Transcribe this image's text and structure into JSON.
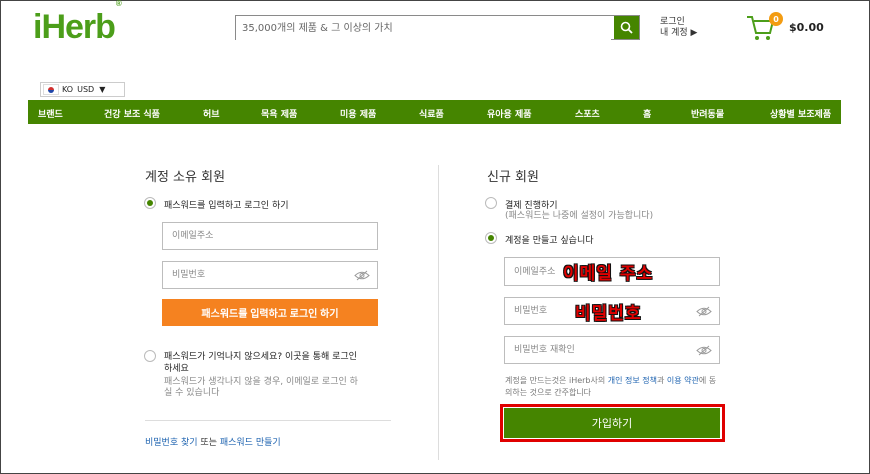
{
  "header": {
    "logo": "iHerb",
    "logo_mark": "®",
    "search_placeholder": "35,000개의 제품 & 그 이상의 가치",
    "login_line1": "로그인",
    "login_line2": "내 계정 ▶",
    "cart_count": "0",
    "cart_total": "$0.00",
    "brand_color": "#4c9e1a"
  },
  "locale": {
    "language": "KO",
    "currency": "USD"
  },
  "nav": {
    "items": [
      "브랜드",
      "건강 보조 식품",
      "허브",
      "목욕 제품",
      "미용 제품",
      "식료품",
      "유아용 제품",
      "스포츠",
      "홈",
      "반려동물",
      "상황별 보조제품"
    ]
  },
  "existing": {
    "title": "계정 소유 회원",
    "option_password": "패스워드를 입력하고 로그인 하기",
    "email_placeholder": "이메일주소",
    "password_placeholder": "비밀번호",
    "login_button": "패스워드를 입력하고 로그인 하기",
    "option_forgot_line1": "패스워드가 기억나지 않으세요? 이곳을 통해 로그인",
    "option_forgot_line2": "하세요",
    "option_forgot_sub1": "패스워드가 생각나지 않을 경우, 이메일로 로그인 하",
    "option_forgot_sub2": "실 수 있습니다",
    "link_find_password": "비밀번호 찾기",
    "link_or": " 또는 ",
    "link_make_password": "패스워드 만들기"
  },
  "new_member": {
    "title": "신규 회원",
    "option_checkout": "결제 진행하기",
    "option_checkout_sub": "(패스워드는 나중에 설정이 가능합니다)",
    "option_create": "계정을 만들고 싶습니다",
    "email_placeholder": "이메일주소",
    "password_placeholder": "비밀번호",
    "confirm_placeholder": "비밀번호 재확인",
    "terms_prefix": "계정을 만드는것은 iHerb사의 ",
    "terms_privacy": "개인 정보 정책",
    "terms_and": "과 ",
    "terms_use": "이용 약관",
    "terms_suffix": "에 동의하는 것으로 간주합니다",
    "signup_button": "가입하기"
  },
  "annotations": {
    "email": "이메일 주소",
    "password": "비밀번호",
    "color": "#e00000"
  }
}
